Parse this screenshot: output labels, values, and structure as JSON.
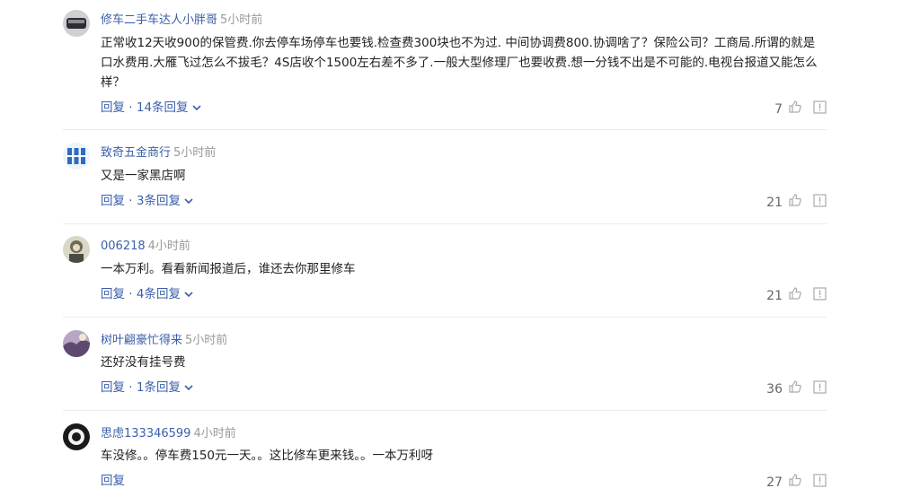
{
  "comments": [
    {
      "user": "修车二手车达人小胖哥",
      "time": "5小时前",
      "content": "正常收12天收900的保管费.你去停车场停车也要钱.检查费300块也不为过. 中间协调费800.协调啥了？保险公司？工商局.所谓的就是口水费用.大雁飞过怎么不拔毛？4S店收个1500左右差不多了.一般大型修理厂也要收费.想一分钱不出是不可能的.电视台报道又能怎么样？",
      "reply": "回复 · 14条回复",
      "likes": "7"
    },
    {
      "user": "致奇五金商行",
      "time": "5小时前",
      "content": "又是一家黑店啊",
      "reply": "回复 · 3条回复",
      "likes": "21"
    },
    {
      "user": "006218",
      "time": "4小时前",
      "content": "一本万利。看看新闻报道后，谁还去你那里修车",
      "reply": "回复 · 4条回复",
      "likes": "21"
    },
    {
      "user": "树叶翩豪忙得来",
      "time": "5小时前",
      "content": "还好没有挂号费",
      "reply": "回复 · 1条回复",
      "likes": "36"
    },
    {
      "user": "思虑133346599",
      "time": "4小时前",
      "content": "车没修。。停车费150元一天。。这比修车更来钱。。一本万利呀",
      "reply": "回复",
      "likes": "27"
    }
  ]
}
